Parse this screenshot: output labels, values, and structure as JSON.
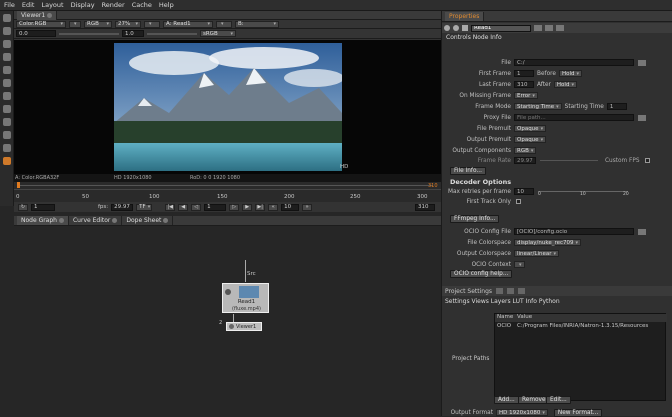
{
  "menu": [
    "File",
    "Edit",
    "Layout",
    "Display",
    "Render",
    "Cache",
    "Help"
  ],
  "viewer": {
    "tab": "Viewer1",
    "colorspace": "Color.RGB",
    "channels": "RGB",
    "zoom": "27%",
    "input_a": "A: Read1",
    "input_b": "B:",
    "gain": "0.0",
    "gamma": "1.0",
    "view_lut": "sRGB",
    "hd_label": "HD",
    "status_left": "A: Color.RGBA32F",
    "status_format": "HD 1920x1080",
    "status_rod": "RoD: 0 0 1920 1080"
  },
  "timeline": {
    "ticks": [
      "0",
      "50",
      "100",
      "150",
      "200",
      "250",
      "300"
    ],
    "end": "310",
    "start": "1",
    "fps_label": "fps:",
    "fps": "29.97",
    "frame_mode": "TF",
    "current": "1",
    "step": "10",
    "last": "310"
  },
  "nodegraph": {
    "tabs": [
      "Node Graph",
      "Curve Editor",
      "Dope Sheet"
    ],
    "src_label": "Src",
    "read_node": "Read1",
    "read_file": "(fluxe.mp4)",
    "input_num": "2",
    "viewer_node": "Viewer1"
  },
  "properties": {
    "tab": "Properties",
    "node_name": "Read1",
    "inner_tabs": "Controls Node Info",
    "file_label": "File",
    "file_value": "C:/",
    "first_frame_label": "First Frame",
    "first_frame": "1",
    "before_label": "Before",
    "before": "Hold",
    "last_frame_label": "Last Frame",
    "last_frame": "310",
    "after_label": "After",
    "after": "Hold",
    "missing_label": "On Missing Frame",
    "missing": "Error",
    "frame_mode_label": "Frame Mode",
    "frame_mode": "Starting Time",
    "starting_time_label": "Starting Time",
    "starting_time": "1",
    "proxy_label": "Proxy File",
    "proxy_placeholder": "File path...",
    "file_premult_label": "File Premult",
    "file_premult": "Opaque",
    "output_premult_label": "Output Premult",
    "output_premult": "Opaque",
    "output_comp_label": "Output Components",
    "output_comp": "RGB",
    "frame_rate_label": "Frame Rate",
    "frame_rate": "29.97",
    "custom_fps_label": "Custom FPS",
    "file_info_btn": "File Info...",
    "decoder_header": "Decoder Options",
    "max_retries_label": "Max retries per frame",
    "max_retries": "10",
    "slider_ticks": [
      "0",
      "10",
      "20"
    ],
    "first_track_label": "First Track Only",
    "ffmpeg_btn": "FFmpeg Info...",
    "ocio_config_label": "OCIO Config File",
    "ocio_config": "[OCIO]/config.ocio",
    "file_cs_label": "File Colorspace",
    "file_cs": "display/nuke_rec709",
    "output_cs_label": "Output Colorspace",
    "output_cs": "linear/Linear",
    "ocio_ctx_label": "OCIO Context",
    "ocio_help_btn": "OCIO config help..."
  },
  "project": {
    "title": "Project Settings",
    "tabs": "Settings Views Layers LUT Info Python",
    "paths_label": "Project Paths",
    "col_name": "Name",
    "col_value": "Value",
    "row_name": "OCIO",
    "row_value": "C:/Program Files/INRIA/Natron-1.3.15/Resources",
    "add_btn": "Add...",
    "remove_btn": "Remove",
    "edit_btn": "Edit...",
    "output_format_label": "Output Format",
    "output_format": "HD 1920x1080",
    "new_format_btn": "New Format..."
  }
}
